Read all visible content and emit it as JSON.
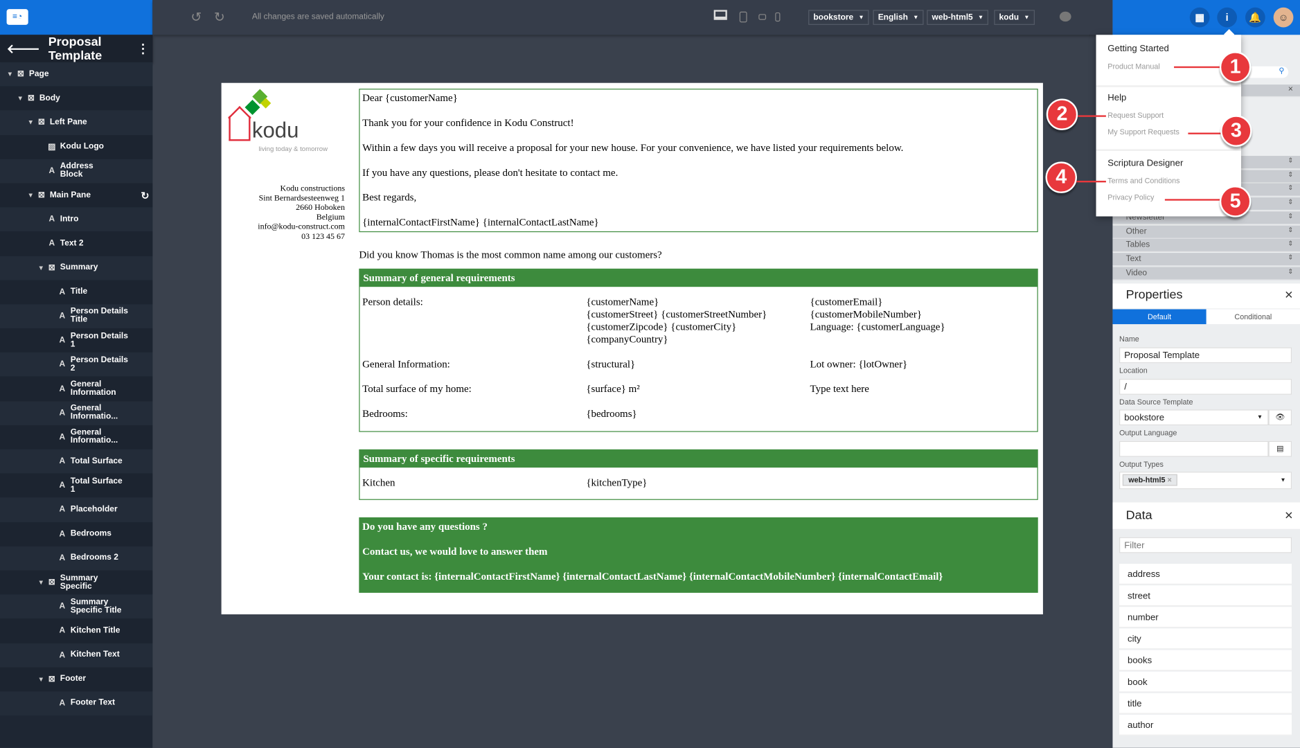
{
  "app": {
    "title": "Proposal Template",
    "save_status": "All changes are saved automatically"
  },
  "toolbar": {
    "selects": [
      "bookstore",
      "English",
      "web-html5",
      "kodu"
    ]
  },
  "tree": [
    {
      "label": "Page",
      "level": 0,
      "type": "container",
      "expanded": true
    },
    {
      "label": "Body",
      "level": 1,
      "type": "container",
      "expanded": true
    },
    {
      "label": "Left Pane",
      "level": 2,
      "type": "container",
      "expanded": true
    },
    {
      "label": "Kodu Logo",
      "level": 3,
      "type": "image"
    },
    {
      "label": "Address Block",
      "level": 3,
      "type": "text"
    },
    {
      "label": "Main Pane",
      "level": 2,
      "type": "container",
      "expanded": true,
      "refresh": true
    },
    {
      "label": "Intro",
      "level": 3,
      "type": "text"
    },
    {
      "label": "Text 2",
      "level": 3,
      "type": "text"
    },
    {
      "label": "Summary",
      "level": 3,
      "type": "container",
      "expanded": true
    },
    {
      "label": "Title",
      "level": 4,
      "type": "text"
    },
    {
      "label": "Person Details Title",
      "level": 4,
      "type": "text"
    },
    {
      "label": "Person Details 1",
      "level": 4,
      "type": "text"
    },
    {
      "label": "Person Details 2",
      "level": 4,
      "type": "text"
    },
    {
      "label": "General Information",
      "level": 4,
      "type": "text"
    },
    {
      "label": "General Informatio...",
      "level": 4,
      "type": "text"
    },
    {
      "label": "General Informatio...",
      "level": 4,
      "type": "text"
    },
    {
      "label": "Total Surface",
      "level": 4,
      "type": "text"
    },
    {
      "label": "Total Surface 1",
      "level": 4,
      "type": "text"
    },
    {
      "label": "Placeholder",
      "level": 4,
      "type": "text"
    },
    {
      "label": "Bedrooms",
      "level": 4,
      "type": "text"
    },
    {
      "label": "Bedrooms 2",
      "level": 4,
      "type": "text"
    },
    {
      "label": "Summary Specific",
      "level": 3,
      "type": "container",
      "expanded": true
    },
    {
      "label": "Summary Specific Title",
      "level": 4,
      "type": "text"
    },
    {
      "label": "Kitchen Title",
      "level": 4,
      "type": "text"
    },
    {
      "label": "Kitchen Text",
      "level": 4,
      "type": "text"
    },
    {
      "label": "Footer",
      "level": 3,
      "type": "container",
      "expanded": true
    },
    {
      "label": "Footer Text",
      "level": 4,
      "type": "text"
    }
  ],
  "doc": {
    "logo_tagline": "living today & tomorrow",
    "logo_text": "kodu",
    "address": [
      "Kodu constructions",
      "Sint Bernardsesteenweg 1",
      "2660 Hoboken",
      "Belgium",
      "info@kodu-construct.com",
      "03 123 45 67"
    ],
    "intro": [
      "Dear {customerName}",
      "Thank you for your confidence in Kodu Construct!",
      "Within a few days you will receive a proposal for your new house. For your convenience, we have listed your requirements below.",
      "If you have any questions, please don't hesitate to contact me.",
      "Best regards,",
      "{internalContactFirstName} {internalContactLastName}"
    ],
    "fact": "Did you know Thomas is the most common name among our customers?",
    "general": {
      "title": "Summary of general requirements",
      "rows": [
        [
          "Person details:",
          "{customerName}\n{customerStreet} {customerStreetNumber}\n{customerZipcode} {customerCity}\n{companyCountry}",
          "{customerEmail}\n{customerMobileNumber}\nLanguage: {customerLanguage}"
        ],
        [
          "General Information:",
          "{structural}",
          "Lot owner: {lotOwner}"
        ],
        [
          "Total surface of my home:",
          "{surface} m²",
          "Type text here"
        ],
        [
          "Bedrooms:",
          "{bedrooms}",
          ""
        ]
      ]
    },
    "specific": {
      "title": "Summary of specific requirements",
      "rows": [
        [
          "Kitchen",
          "{kitchenType}"
        ]
      ]
    },
    "footer": [
      "Do you have any questions ?",
      "Contact us, we would love to answer them",
      "Your contact is: {internalContactFirstName} {internalContactLastName} {internalContactMobileNumber} {internalContactEmail}"
    ]
  },
  "menu": {
    "sections": [
      {
        "title": "Getting Started",
        "items": [
          "Product Manual"
        ]
      },
      {
        "title": "Help",
        "items": [
          "Request Support",
          "My Support Requests"
        ]
      },
      {
        "title": "Scriptura Designer",
        "items": [
          "Terms and Conditions",
          "Privacy Policy"
        ]
      }
    ],
    "callouts": [
      "1",
      "2",
      "3",
      "4",
      "5"
    ]
  },
  "components": [
    "Newsletter",
    "Other",
    "Tables",
    "Text",
    "Video"
  ],
  "properties": {
    "title": "Properties",
    "tabs": [
      "Default",
      "Conditional"
    ],
    "active_tab": "Default",
    "name_label": "Name",
    "name": "Proposal Template",
    "location_label": "Location",
    "location": "/",
    "dst_label": "Data Source Template",
    "dst": "bookstore",
    "lang_label": "Output Language",
    "lang": "",
    "types_label": "Output Types",
    "types_chip": "web-html5"
  },
  "data": {
    "title": "Data",
    "filter_placeholder": "Filter",
    "items": [
      "address",
      "street",
      "number",
      "city",
      "books",
      "book",
      "title",
      "author"
    ]
  },
  "colors": {
    "brand": "#1071dc",
    "green": "#3d8b3d",
    "callout": "#e8383c"
  }
}
